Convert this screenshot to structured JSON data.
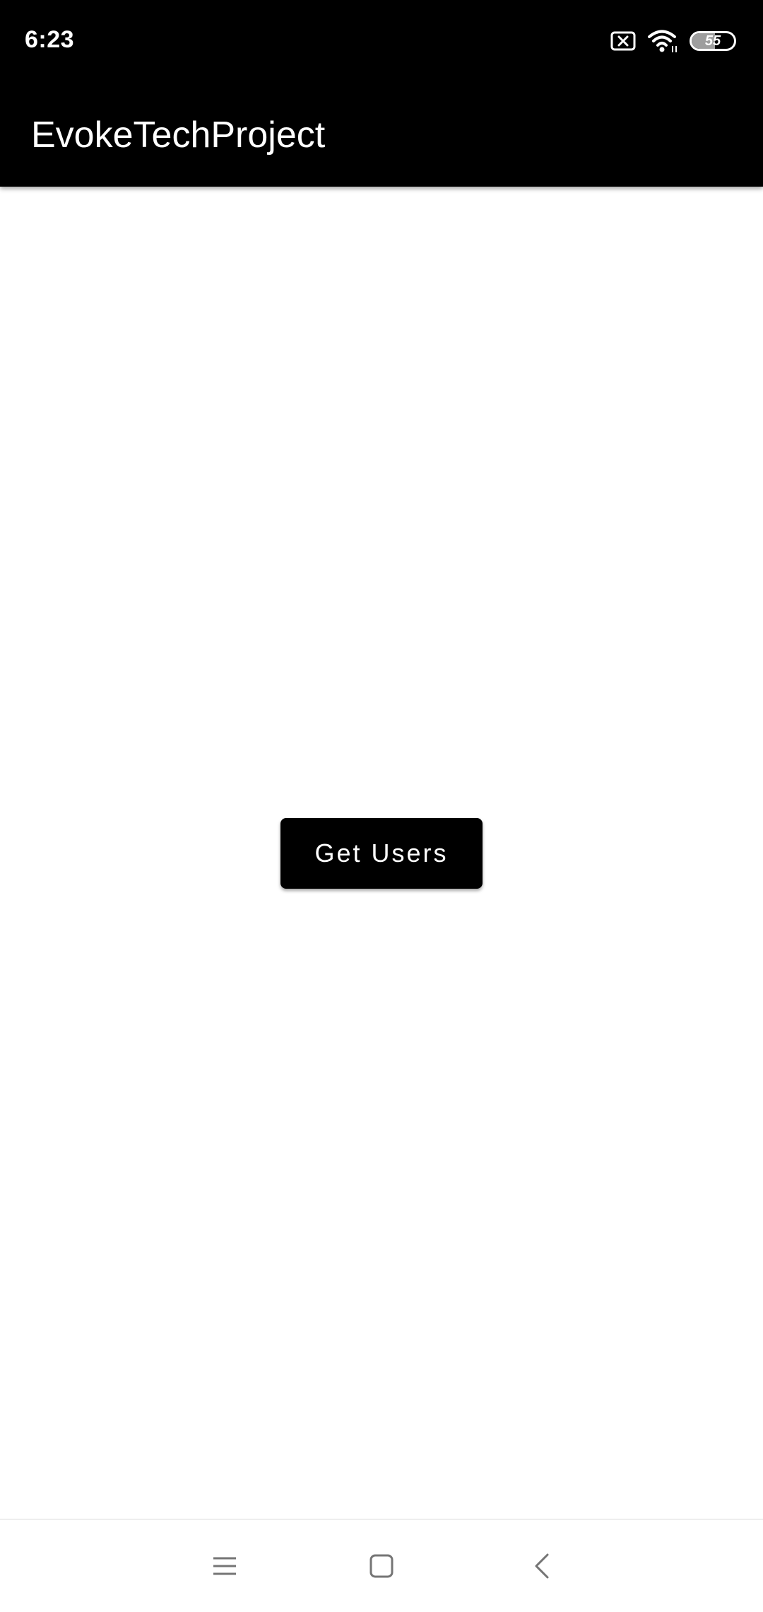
{
  "status_bar": {
    "time": "6:23",
    "battery_level": "55",
    "battery_fraction": 0.55,
    "icons": [
      "screenshot-blocked-icon",
      "wifi-icon",
      "battery-icon"
    ]
  },
  "app_bar": {
    "title": "EvokeTechProject"
  },
  "main": {
    "get_users_label": "Get Users"
  },
  "nav_bar": {
    "icons": [
      "recents-menu-icon",
      "home-icon",
      "back-icon"
    ]
  },
  "colors": {
    "bar_background": "#000000",
    "button_background": "#000000",
    "button_text": "#ffffff",
    "page_background": "#ffffff"
  }
}
